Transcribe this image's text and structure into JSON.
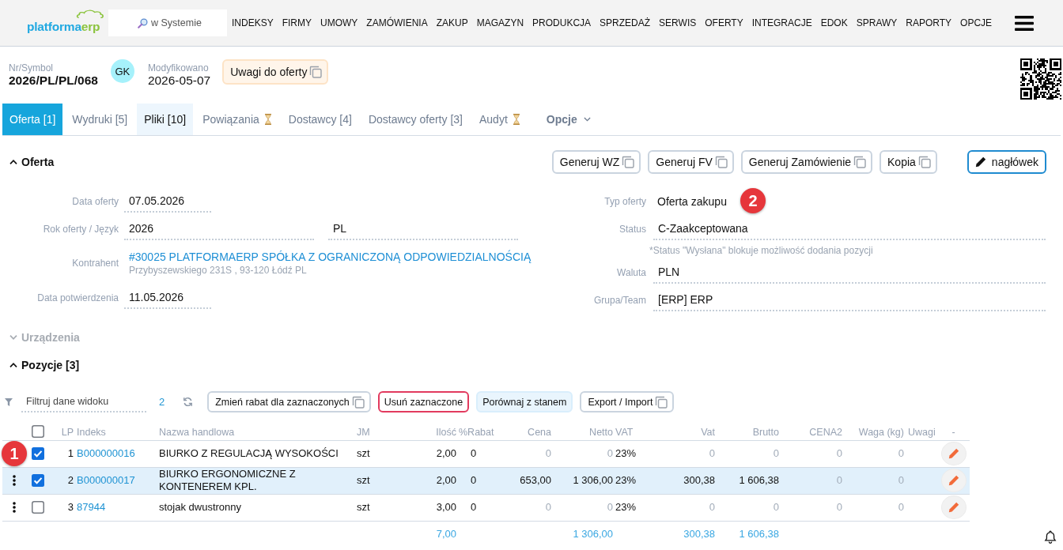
{
  "topbar": {
    "logo": {
      "text": "platforma",
      "accent": "erp"
    },
    "search": {
      "placeholder": "w Systemie"
    },
    "nav": [
      "INDEKSY",
      "FIRMY",
      "UMOWY",
      "ZAMÓWIENIA",
      "ZAKUP",
      "MAGAZYN",
      "PRODUKCJA",
      "SPRZEDAŻ",
      "SERWIS",
      "OFERTY",
      "INTEGRACJE",
      "EDOK",
      "SPRAWY",
      "RAPORTY",
      "OPCJE"
    ]
  },
  "header": {
    "symbol": {
      "label": "Nr/Symbol",
      "value": "2026/PL/PL/068"
    },
    "avatar": "GK",
    "modified": {
      "label": "Modyfikowano",
      "value": "2026-05-07"
    },
    "notes_button": {
      "label": "Uwagi do oferty",
      "kind": "note"
    }
  },
  "tabs": [
    {
      "label": "Oferta [1]",
      "selected": true,
      "highlighted": false,
      "pending": false
    },
    {
      "label": "Wydruki [5]",
      "selected": false,
      "highlighted": false,
      "pending": false
    },
    {
      "label": "Pliki [10]",
      "selected": false,
      "highlighted": true,
      "pending": false
    },
    {
      "label": "Powiązania",
      "selected": false,
      "highlighted": false,
      "pending": true
    },
    {
      "label": "Dostawcy [4]",
      "selected": false,
      "highlighted": false,
      "pending": false
    },
    {
      "label": "Dostawcy oferty [3]",
      "selected": false,
      "highlighted": false,
      "pending": false
    },
    {
      "label": "Audyt",
      "selected": false,
      "highlighted": false,
      "pending": true
    }
  ],
  "options_menu": {
    "label": "Opcje"
  },
  "offer_section": {
    "title": "Oferta",
    "expanded": true,
    "disabled": false,
    "actions": [
      {
        "label": "Generuj WZ",
        "kind": "copy"
      },
      {
        "label": "Generuj FV",
        "kind": "copy"
      },
      {
        "label": "Generuj Zamówienie",
        "kind": "copy"
      },
      {
        "label": "Kopia",
        "kind": "copy"
      },
      {
        "label": "nagłówek",
        "kind": "edit"
      }
    ],
    "fields_left": [
      {
        "label": "Data oferty",
        "kind": "date",
        "value": "07.05.2026"
      },
      {
        "label": "Rok oferty / Język",
        "kind": "pair",
        "values": [
          "2026",
          "PL"
        ]
      },
      {
        "label": "Kontrahent",
        "kind": "link",
        "value": "#30025 PLATFORMAERP SPÓŁKA Z OGRANICZONĄ ODPOWIEDZIALNOŚCIĄ",
        "detail": "Przybyszewskiego 231S , 93-120 Łódź PL"
      },
      {
        "label": "Data potwierdzenia",
        "kind": "date",
        "value": "11.05.2026"
      }
    ],
    "fields_right": [
      {
        "label": "Typ oferty",
        "kind": "text",
        "value": "Oferta zakupu"
      },
      {
        "label": "Status",
        "kind": "input",
        "value": "C-Zaakceptowana",
        "hint": "*Status \"Wysłana\" blokuje możliwość dodania pozycji"
      },
      {
        "label": "Waluta",
        "kind": "input",
        "value": "PLN"
      },
      {
        "label": "Grupa/Team",
        "kind": "input",
        "value": "[ERP] ERP"
      }
    ]
  },
  "devices_section": {
    "title": "Urządzenia",
    "expanded": false,
    "disabled": true
  },
  "items_section": {
    "title": "Pozycje [3]",
    "expanded": true,
    "disabled": false,
    "toolbar": {
      "filter": {
        "placeholder": "Filtruj dane widoku"
      },
      "selected_count": "2",
      "buttons": [
        {
          "label": "Zmień rabat dla zaznaczonych",
          "kind": "copy"
        },
        {
          "label": "Usuń zaznaczone",
          "kind": "danger"
        },
        {
          "label": "Porównaj z stanem",
          "kind": "info"
        },
        {
          "label": "Export / Import",
          "kind": "copy"
        }
      ]
    },
    "table": {
      "all_checked": false,
      "columns": [
        "LP",
        "Indeks",
        "Nazwa handlowa",
        "JM",
        "Ilość",
        "%Rabat",
        "Cena",
        "Netto",
        "VAT",
        "Vat",
        "Brutto",
        "CENA2",
        "Waga (kg)",
        "Uwagi",
        "-"
      ],
      "rows": [
        {
          "checked": true,
          "highlighted": false,
          "menu": false,
          "lp": "1",
          "index": "B000000016",
          "name": "BIURKO Z REGULACJĄ WYSOKOŚCI",
          "unit": "szt",
          "qty": "2,00",
          "discount": "0",
          "price": {
            "text": "0",
            "muted": true
          },
          "net": {
            "text": "0",
            "muted": true
          },
          "vat_rate": "23%",
          "vat": {
            "text": "0",
            "muted": true
          },
          "gross": {
            "text": "0",
            "muted": true
          },
          "price2": {
            "text": "0",
            "muted": true
          },
          "weight": {
            "text": "0",
            "muted": true
          }
        },
        {
          "checked": true,
          "highlighted": true,
          "menu": true,
          "lp": "2",
          "index": "B000000017",
          "name": "BIURKO ERGONOMICZNE Z KONTENEREM KPL.",
          "unit": "szt",
          "qty": "2,00",
          "discount": "0",
          "price": {
            "text": "653,00",
            "muted": false
          },
          "net": {
            "text": "1 306,00",
            "muted": false
          },
          "vat_rate": "23%",
          "vat": {
            "text": "300,38",
            "muted": false
          },
          "gross": {
            "text": "1 606,38",
            "muted": false
          },
          "price2": {
            "text": "0",
            "muted": true
          },
          "weight": {
            "text": "0",
            "muted": true
          }
        },
        {
          "checked": false,
          "highlighted": false,
          "menu": true,
          "lp": "3",
          "index": "87944",
          "name": "stojak dwustronny",
          "unit": "szt",
          "qty": "3,00",
          "discount": "0",
          "price": {
            "text": "0",
            "muted": true
          },
          "net": {
            "text": "0",
            "muted": true
          },
          "vat_rate": "23%",
          "vat": {
            "text": "0",
            "muted": true
          },
          "gross": {
            "text": "0",
            "muted": true
          },
          "price2": {
            "text": "0",
            "muted": true
          },
          "weight": {
            "text": "0",
            "muted": true
          }
        }
      ],
      "totals": {
        "qty": "7,00",
        "net": "1 306,00",
        "vat": "300,38",
        "gross": "1 606,38"
      }
    }
  },
  "markers": [
    {
      "label": "1"
    },
    {
      "label": "2"
    }
  ]
}
